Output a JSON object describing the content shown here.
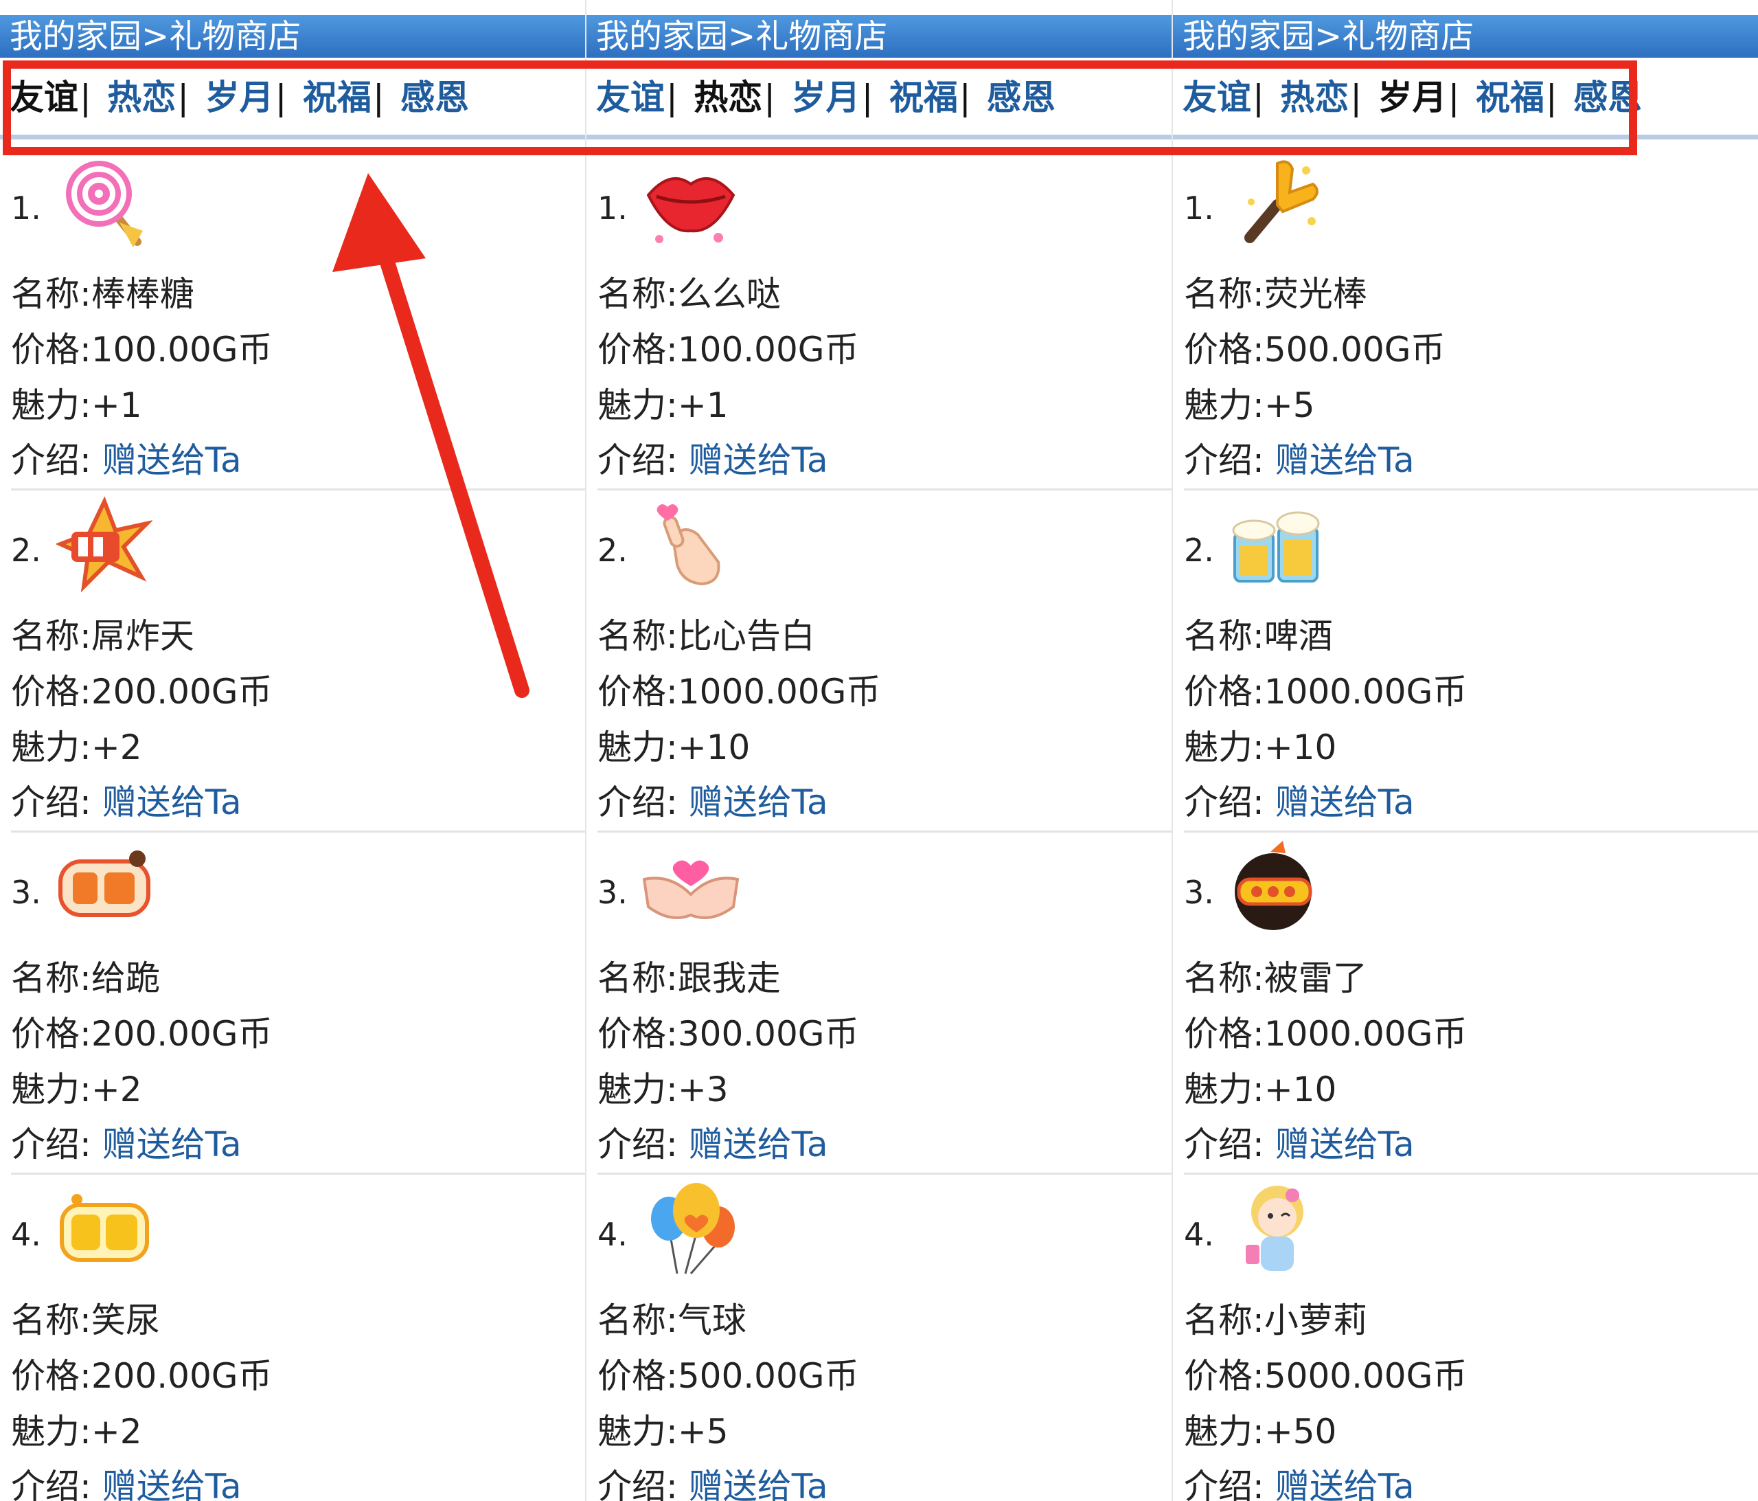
{
  "panels": [
    {
      "title": "我的家园>礼物商店",
      "tabs": [
        "友谊",
        "热恋",
        "岁月",
        "祝福",
        "感恩"
      ],
      "active_tab": 0,
      "items": [
        {
          "num": "1.",
          "icon": "lollipop-gift-icon",
          "name_line": "名称:棒棒糖",
          "price_line": "价格:100.00G币",
          "charm_line": "魅力:+1",
          "intro_label": "介绍: ",
          "intro_link": "赠送给Ta"
        },
        {
          "num": "2.",
          "icon": "firecracker-sticker-icon",
          "name_line": "名称:屌炸天",
          "price_line": "价格:200.00G币",
          "charm_line": "魅力:+2",
          "intro_label": "介绍: ",
          "intro_link": "赠送给Ta"
        },
        {
          "num": "3.",
          "icon": "kneel-sticker-icon",
          "name_line": "名称:给跪",
          "price_line": "价格:200.00G币",
          "charm_line": "魅力:+2",
          "intro_label": "介绍: ",
          "intro_link": "赠送给Ta"
        },
        {
          "num": "4.",
          "icon": "laugh-sticker-icon",
          "name_line": "名称:笑尿",
          "price_line": "价格:200.00G币",
          "charm_line": "魅力:+2",
          "intro_label": "介绍: ",
          "intro_link": "赠送给Ta"
        }
      ]
    },
    {
      "title": "我的家园>礼物商店",
      "tabs": [
        "友谊",
        "热恋",
        "岁月",
        "祝福",
        "感恩"
      ],
      "active_tab": 1,
      "items": [
        {
          "num": "1.",
          "icon": "lips-kiss-icon",
          "name_line": "名称:么么哒",
          "price_line": "价格:100.00G币",
          "charm_line": "魅力:+1",
          "intro_label": "介绍: ",
          "intro_link": "赠送给Ta"
        },
        {
          "num": "2.",
          "icon": "finger-heart-icon",
          "name_line": "名称:比心告白",
          "price_line": "价格:1000.00G币",
          "charm_line": "魅力:+10",
          "intro_label": "介绍: ",
          "intro_link": "赠送给Ta"
        },
        {
          "num": "3.",
          "icon": "holding-hands-icon",
          "name_line": "名称:跟我走",
          "price_line": "价格:300.00G币",
          "charm_line": "魅力:+3",
          "intro_label": "介绍: ",
          "intro_link": "赠送给Ta"
        },
        {
          "num": "4.",
          "icon": "balloons-icon",
          "name_line": "名称:气球",
          "price_line": "价格:500.00G币",
          "charm_line": "魅力:+5",
          "intro_label": "介绍: ",
          "intro_link": "赠送给Ta"
        }
      ]
    },
    {
      "title": "我的家园>礼物商店",
      "tabs": [
        "友谊",
        "热恋",
        "岁月",
        "祝福",
        "感恩"
      ],
      "active_tab": 2,
      "items": [
        {
          "num": "1.",
          "icon": "glow-stick-icon",
          "name_line": "名称:荧光棒",
          "price_line": "价格:500.00G币",
          "charm_line": "魅力:+5",
          "intro_label": "介绍: ",
          "intro_link": "赠送给Ta"
        },
        {
          "num": "2.",
          "icon": "beer-mugs-icon",
          "name_line": "名称:啤酒",
          "price_line": "价格:1000.00G币",
          "charm_line": "魅力:+10",
          "intro_label": "介绍: ",
          "intro_link": "赠送给Ta"
        },
        {
          "num": "3.",
          "icon": "boom-bomb-icon",
          "name_line": "名称:被雷了",
          "price_line": "价格:1000.00G币",
          "charm_line": "魅力:+10",
          "intro_label": "介绍: ",
          "intro_link": "赠送给Ta"
        },
        {
          "num": "4.",
          "icon": "little-girl-icon",
          "name_line": "名称:小萝莉",
          "price_line": "价格:5000.00G币",
          "charm_line": "魅力:+50",
          "intro_label": "介绍: ",
          "intro_link": "赠送给Ta"
        }
      ]
    }
  ],
  "colors": {
    "titlebar": "#2d6fc1",
    "tab_link": "#1f5c9e",
    "annotation_red": "#e8291c"
  }
}
